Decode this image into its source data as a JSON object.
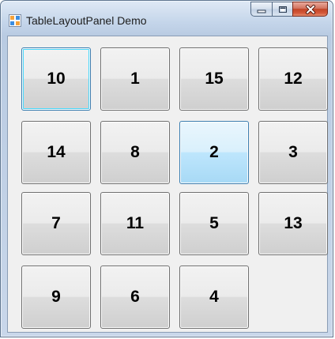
{
  "window": {
    "title": "TableLayoutPanel Demo",
    "icon": "winforms-app-icon"
  },
  "caption_buttons": {
    "minimize_icon": "minimize-icon",
    "maximize_icon": "maximize-icon",
    "close_icon": "close-icon",
    "close_color": "#c24527"
  },
  "tiles": [
    {
      "label": "10",
      "state": "focused"
    },
    {
      "label": "1",
      "state": "normal"
    },
    {
      "label": "15",
      "state": "normal"
    },
    {
      "label": "12",
      "state": "normal"
    },
    {
      "label": "14",
      "state": "normal"
    },
    {
      "label": "8",
      "state": "normal"
    },
    {
      "label": "2",
      "state": "hover"
    },
    {
      "label": "3",
      "state": "normal"
    },
    {
      "label": "7",
      "state": "normal"
    },
    {
      "label": "11",
      "state": "normal"
    },
    {
      "label": "5",
      "state": "normal"
    },
    {
      "label": "13",
      "state": "normal"
    },
    {
      "label": "9",
      "state": "normal"
    },
    {
      "label": "6",
      "state": "normal"
    },
    {
      "label": "4",
      "state": "normal"
    }
  ],
  "empty_cell": {
    "row": 4,
    "column": 4
  }
}
